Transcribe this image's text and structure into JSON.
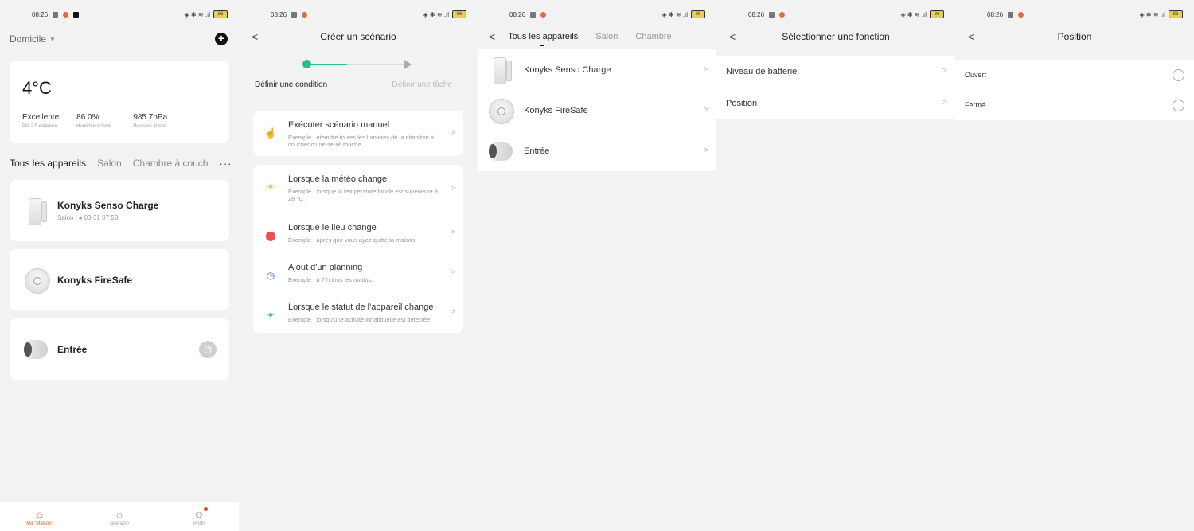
{
  "status": {
    "time": "08:26",
    "battery": "86"
  },
  "panel1": {
    "home_title": "Domicile",
    "weather": {
      "temperature": "4°C",
      "stats": [
        {
          "value": "Excellente",
          "label": "PM 2.5 extérieur"
        },
        {
          "value": "86.0%",
          "label": "Humidité à l'exté..."
        },
        {
          "value": "985.7hPa",
          "label": "Pression Atmos..."
        }
      ]
    },
    "tabs": [
      "Tous les appareils",
      "Salon",
      "Chambre à couch"
    ],
    "more": "···",
    "devices": [
      {
        "name": "Konyks Senso Charge",
        "sub_room": "Salon",
        "sub_time": "03-31 07:53"
      },
      {
        "name": "Konyks FireSafe"
      },
      {
        "name": "Entrée"
      }
    ],
    "nav": [
      {
        "label": "Ma \"Maison\"",
        "icon": "home-icon"
      },
      {
        "label": "Scénario",
        "icon": "sun-icon"
      },
      {
        "label": "Profil",
        "icon": "profile-icon"
      }
    ]
  },
  "panel2": {
    "title": "Créer un scénario",
    "step1": "Définir une condition",
    "step2": "Définir une tâche",
    "manual": {
      "title": "Exécuter scénario manuel",
      "desc": "Exemple : éteindre toutes les lumières de la chambre à coucher d'une seule touche."
    },
    "conditions": [
      {
        "title": "Lorsque la météo change",
        "desc": "Exemple : lorsque la température locale est supérieure à 28 °C.",
        "icon": "sun-icon",
        "color": "#f5a623"
      },
      {
        "title": "Lorsque le lieu change",
        "desc": "Exemple : après que vous ayez quitté la maison.",
        "icon": "location-pin-icon",
        "color": "#f05050"
      },
      {
        "title": "Ajout d'un planning",
        "desc": "Exemple : à 7 h tous les matins.",
        "icon": "clock-icon",
        "color": "#3b7be0"
      },
      {
        "title": "Lorsque le statut de l'appareil change",
        "desc": "Exemple : lorsqu'une activité inhabituelle est détectée.",
        "icon": "bulb-icon",
        "color": "#2bc38a"
      }
    ]
  },
  "panel3": {
    "tabs": [
      "Tous les appareils",
      "Salon",
      "Chambre"
    ],
    "devices": [
      "Konyks Senso Charge",
      "Konyks FireSafe",
      "Entrée"
    ]
  },
  "panel4": {
    "title": "Sélectionner une fonction",
    "items": [
      "Niveau de batterie",
      "Position"
    ]
  },
  "panel5": {
    "title": "Position",
    "options": [
      "Ouvert",
      "Fermé"
    ]
  },
  "colors": {
    "accent": "#f05a23",
    "green": "#2bbf8c"
  }
}
